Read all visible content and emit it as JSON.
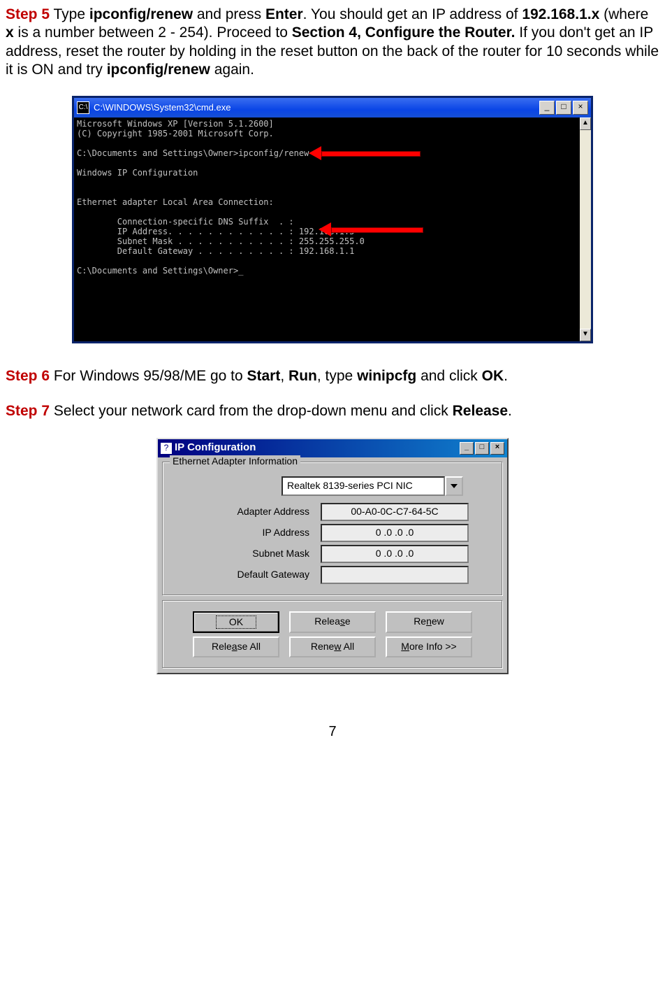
{
  "step5": {
    "label": "Step 5",
    "t1": " Type ",
    "cmd": "ipconfig/renew",
    "t2": " and press ",
    "enter": "Enter",
    "t3": ". You should get an IP address of ",
    "ip": "192.168.1.x",
    "t4": " (where ",
    "x": "x",
    "t5": " is a number between 2 - 254). Proceed to ",
    "section": "Section 4, Configure the Router.",
    "t6": " If you don't get an IP address, reset the router by holding in the reset button on the back of the router for 10 seconds while it is ON and try ",
    "cmd2": "ipconfig/renew",
    "t7": " again."
  },
  "cmd": {
    "title": "C:\\WINDOWS\\System32\\cmd.exe",
    "lines": [
      "Microsoft Windows XP [Version 5.1.2600]",
      "(C) Copyright 1985-2001 Microsoft Corp.",
      "",
      "C:\\Documents and Settings\\Owner>ipconfig/renew",
      "",
      "Windows IP Configuration",
      "",
      "",
      "Ethernet adapter Local Area Connection:",
      "",
      "        Connection-specific DNS Suffix  . :",
      "        IP Address. . . . . . . . . . . . : 192.168.1.5",
      "        Subnet Mask . . . . . . . . . . . : 255.255.255.0",
      "        Default Gateway . . . . . . . . . : 192.168.1.1",
      "",
      "C:\\Documents and Settings\\Owner>_"
    ]
  },
  "step6": {
    "label": "Step 6",
    "t1": " For Windows 95/98/ME go to ",
    "start": "Start",
    "t2": ", ",
    "run": "Run",
    "t3": ", type ",
    "winipcfg": "winipcfg",
    "t4": " and click ",
    "ok": "OK",
    "t5": "."
  },
  "step7": {
    "label": "Step 7",
    "t1": " Select your network card from the drop-down menu and click ",
    "release": "Release",
    "t2": "."
  },
  "ipcfg": {
    "title": "IP Configuration",
    "group": "Ethernet Adapter Information",
    "nic": "Realtek 8139-series PCI NIC",
    "labels": {
      "adapter": "Adapter Address",
      "ip": "IP Address",
      "mask": "Subnet Mask",
      "gw": "Default Gateway"
    },
    "values": {
      "adapter": "00-A0-0C-C7-64-5C",
      "ip": "0 .0 .0 .0",
      "mask": "0 .0 .0 .0",
      "gw": ""
    },
    "buttons": {
      "ok": "OK",
      "release_pre": "Relea",
      "release_u": "s",
      "release_post": "e",
      "renew_pre": "Re",
      "renew_u": "n",
      "renew_post": "ew",
      "release_all_pre": "Rele",
      "release_all_u": "a",
      "release_all_post": "se All",
      "renew_all_pre": "Rene",
      "renew_all_u": "w",
      "renew_all_post": " All",
      "more_pre": "",
      "more_u": "M",
      "more_post": "ore Info >>"
    }
  },
  "page_number": "7"
}
